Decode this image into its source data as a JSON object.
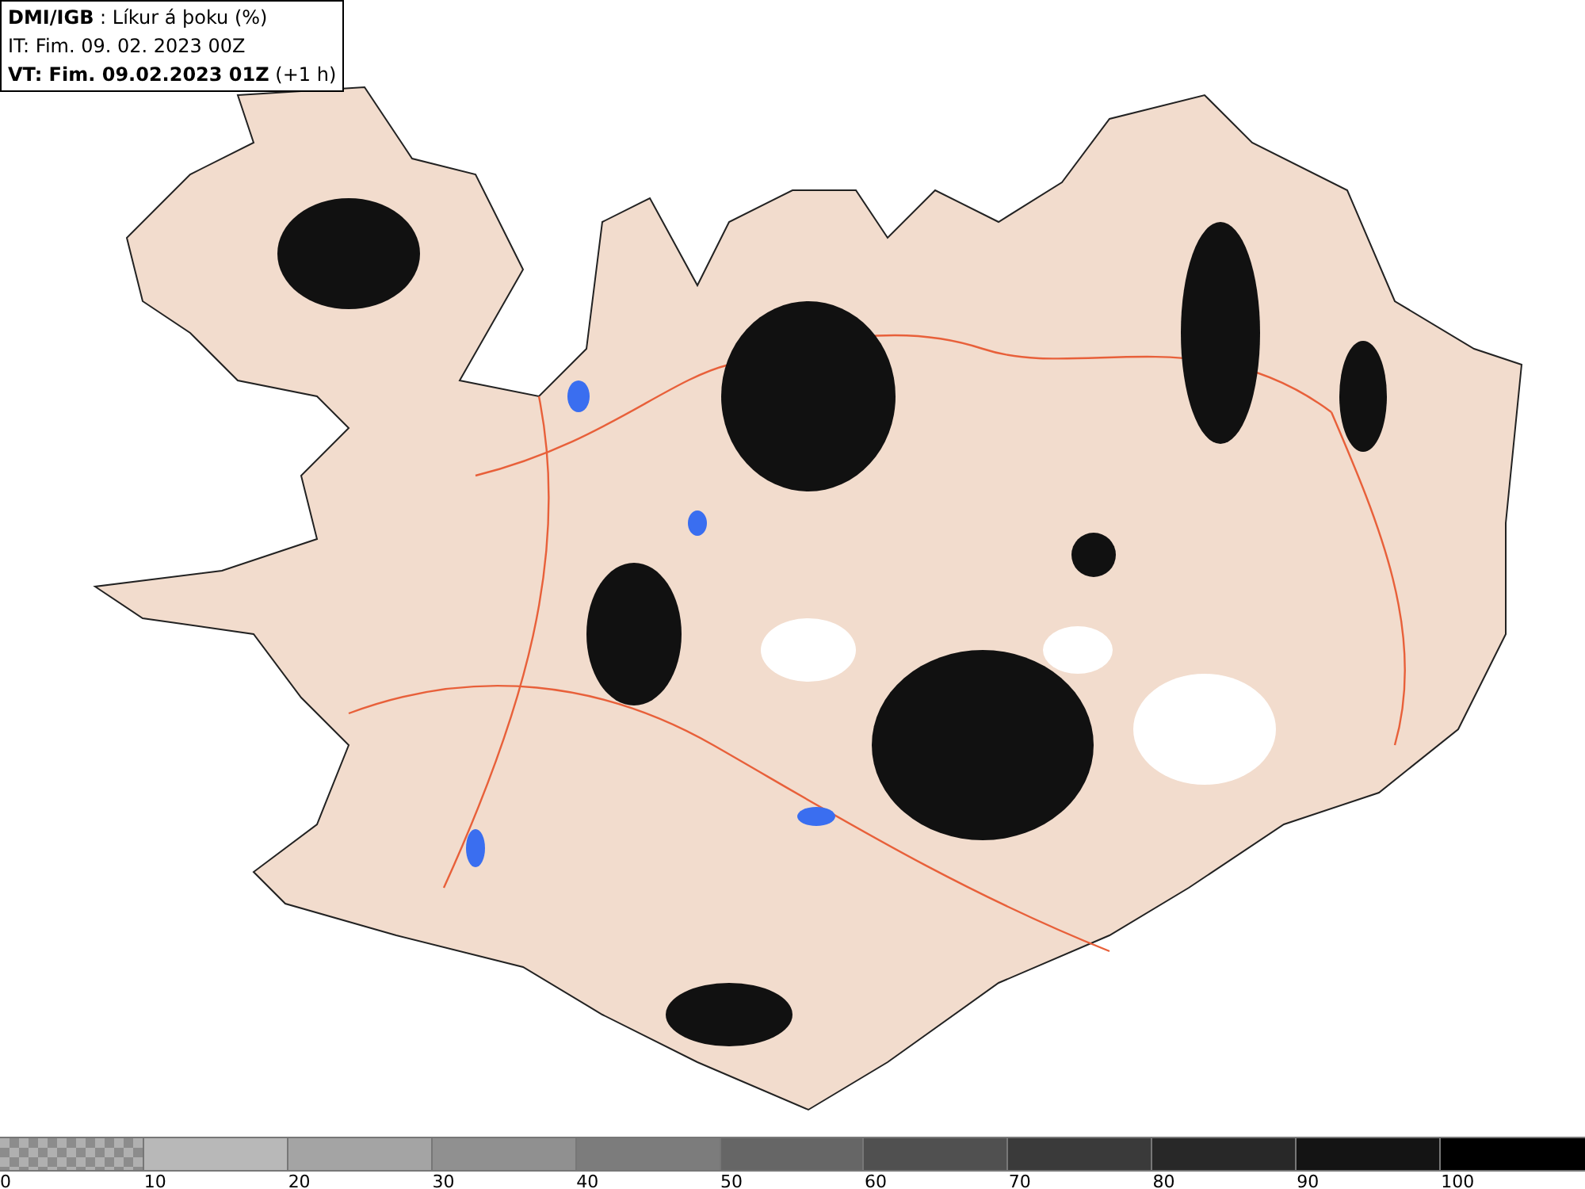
{
  "info_box": {
    "lines": [
      "**DMI/IGB** : Líkur á þoku (%)",
      "IT: Fim. 09. 02. 2023 00Z",
      "**VT: Fim. 09.02.2023 01Z** (+1 h)"
    ]
  },
  "legend": {
    "bins": [
      {
        "kind": "checker",
        "color": "#8c8c8c",
        "label": "0"
      },
      {
        "kind": "solid",
        "color": "#b8b8b8",
        "label": "10"
      },
      {
        "kind": "solid",
        "color": "#a4a4a4",
        "label": "20"
      },
      {
        "kind": "solid",
        "color": "#909090",
        "label": "30"
      },
      {
        "kind": "solid",
        "color": "#7c7c7c",
        "label": "40"
      },
      {
        "kind": "solid",
        "color": "#666666",
        "label": "50"
      },
      {
        "kind": "solid",
        "color": "#505050",
        "label": "60"
      },
      {
        "kind": "solid",
        "color": "#3a3a3a",
        "label": "70"
      },
      {
        "kind": "solid",
        "color": "#282828",
        "label": "80"
      },
      {
        "kind": "solid",
        "color": "#141414",
        "label": "90"
      },
      {
        "kind": "solid",
        "color": "#000000",
        "label": "100"
      }
    ]
  }
}
